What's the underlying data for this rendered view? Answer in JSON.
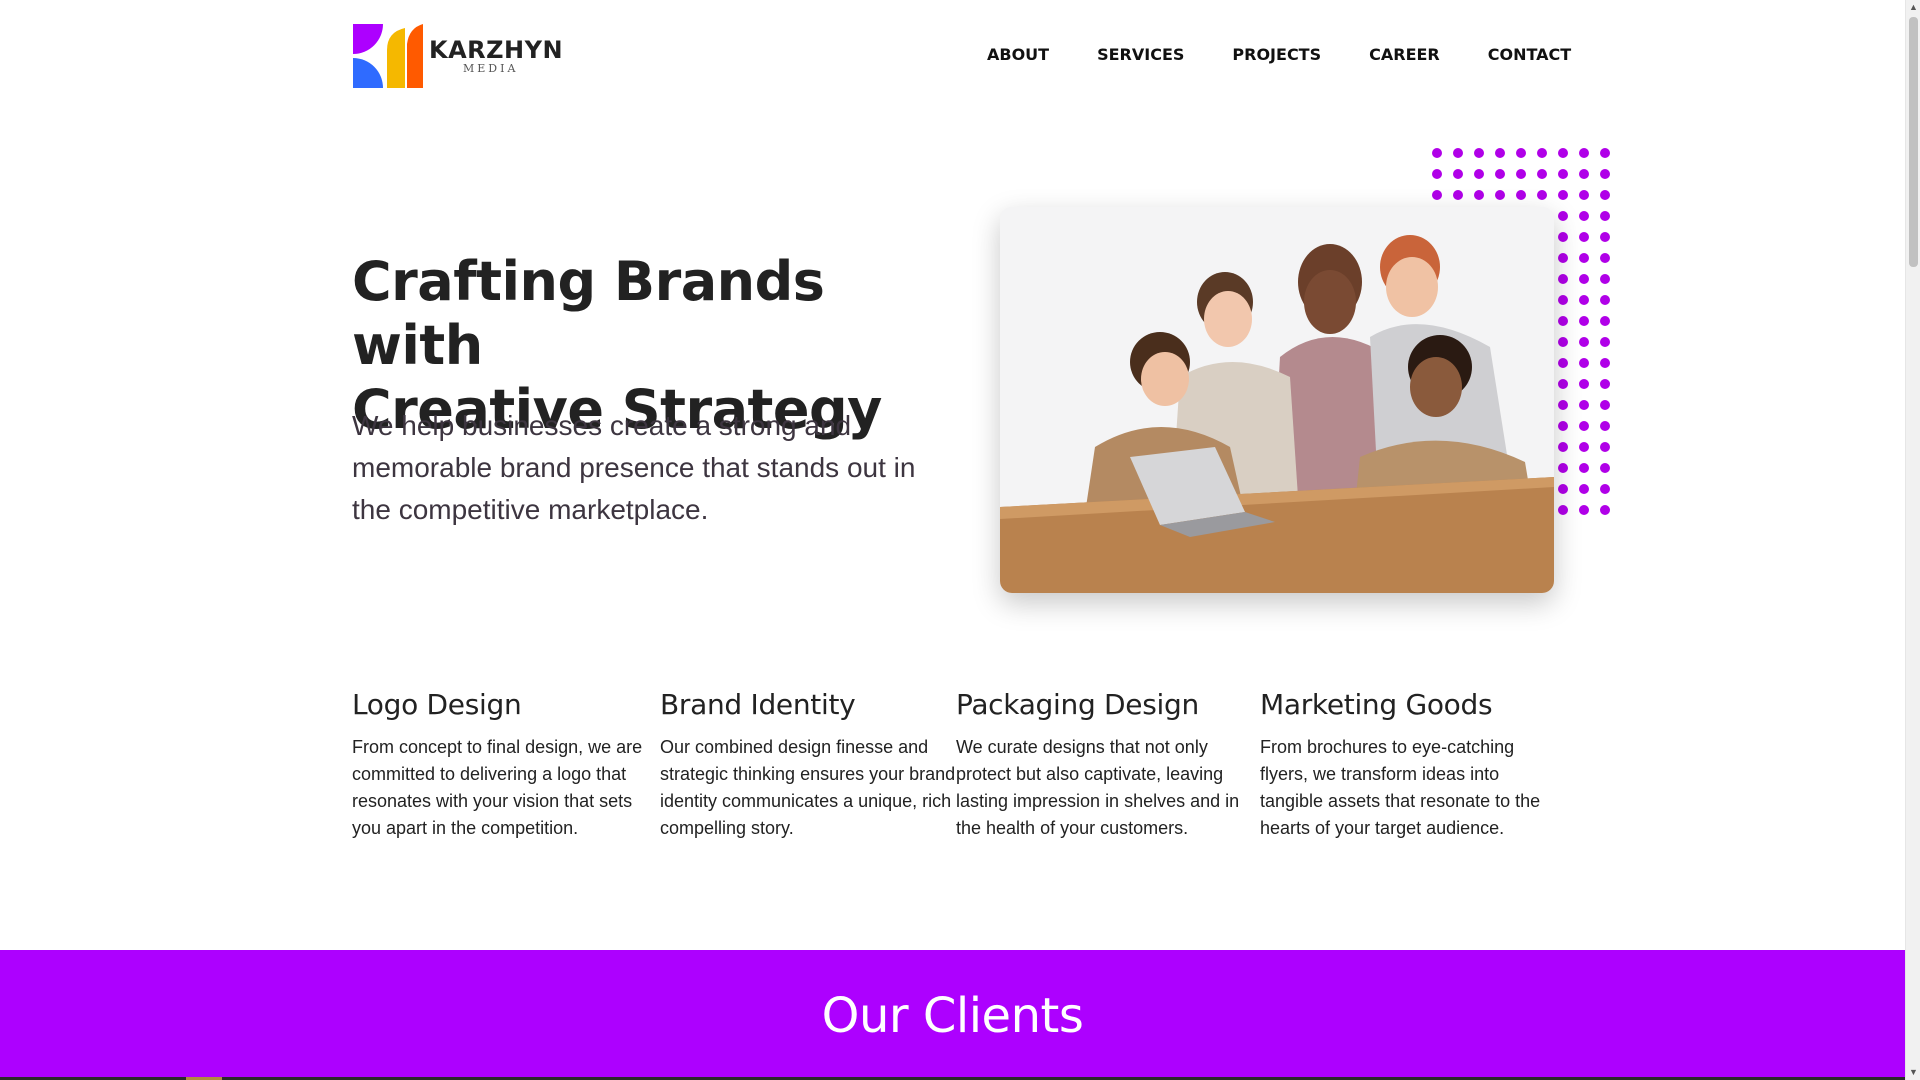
{
  "brand": {
    "name": "KARZHYN",
    "sub": "MEDIA",
    "colors": {
      "purple": "#ad00ff",
      "yellow": "#f5b800",
      "orange": "#ff5a00",
      "blue": "#2f6bff"
    }
  },
  "nav": {
    "items": [
      {
        "label": "ABOUT"
      },
      {
        "label": "SERVICES"
      },
      {
        "label": "PROJECTS"
      },
      {
        "label": "CAREER"
      },
      {
        "label": "CONTACT"
      }
    ]
  },
  "hero": {
    "title_line1": "Crafting Brands with",
    "title_line2": "Creative Strategy",
    "text": "We help businesses create a strong and memorable brand presence that stands out in the competitive marketplace.",
    "accent_color": "#b000e8"
  },
  "services": [
    {
      "title": "Logo Design",
      "text": "From concept to final design, we are committed to delivering a logo that resonates with your vision that sets you apart in the competition."
    },
    {
      "title": "Brand Identity",
      "text": "Our combined design finesse and strategic thinking ensures your brand identity communicates a unique, rich compelling story."
    },
    {
      "title": "Packaging Design",
      "text": "We curate designs that not only protect but also captivate, leaving lasting impression in shelves and in the health of your customers."
    },
    {
      "title": "Marketing Goods",
      "text": "From brochures to eye-catching flyers, we transform ideas into tangible assets that resonate to the hearts of your target audience."
    }
  ],
  "clients": {
    "title": "Our Clients",
    "background": "#ad00ff"
  }
}
